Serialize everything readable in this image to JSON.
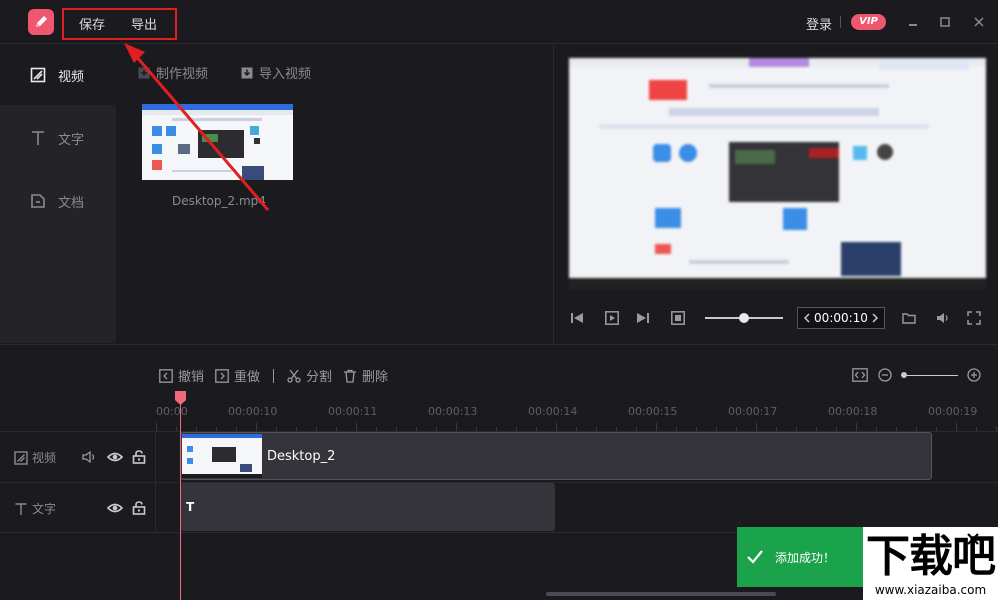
{
  "titlebar": {
    "menu": [
      {
        "label": "保存"
      },
      {
        "label": "导出"
      }
    ],
    "login_label": "登录",
    "vip_label": "VIP"
  },
  "leftnav": {
    "items": [
      {
        "label": "视频",
        "icon": "video-icon",
        "active": true
      },
      {
        "label": "文字",
        "icon": "text-icon",
        "active": false
      },
      {
        "label": "文档",
        "icon": "document-icon",
        "active": false
      }
    ]
  },
  "media": {
    "make_video_label": "制作视频",
    "import_video_label": "导入视频",
    "files": [
      {
        "name": "Desktop_2.mp4"
      }
    ]
  },
  "preview": {
    "timecode": "00:00:10",
    "volume_fraction": 0.5
  },
  "timeline": {
    "tools": [
      {
        "label": "撤销",
        "icon": "undo-icon"
      },
      {
        "label": "重做",
        "icon": "redo-icon"
      },
      {
        "label": "分割",
        "icon": "scissors-icon"
      },
      {
        "label": "删除",
        "icon": "trash-icon"
      }
    ],
    "ruler_start_label": "00:00",
    "ruler_labels": [
      "00:00:10",
      "00:00:11",
      "00:00:13",
      "00:00:14",
      "00:00:15",
      "00:00:17",
      "00:00:18",
      "00:00:19"
    ],
    "tracks": [
      {
        "label": "视频",
        "icon": "video-icon"
      },
      {
        "label": "文字",
        "icon": "text-icon"
      }
    ],
    "video_clip_title": "Desktop_2",
    "text_clip_title": "T"
  },
  "toast": {
    "message": "添加成功！"
  },
  "watermark": {
    "big": "下载吧",
    "small": "www.xiazaiba.com"
  },
  "colors": {
    "accent": "#f0566d",
    "toast_green": "#1aa34a",
    "annotation_red": "#e02020"
  }
}
